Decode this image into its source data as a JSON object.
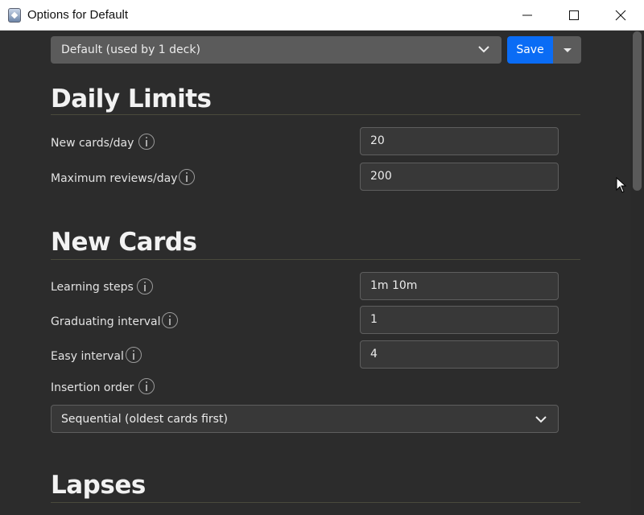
{
  "window": {
    "title": "Options for Default",
    "icon": "anki-app-icon",
    "controls": [
      "minimize",
      "maximize",
      "close"
    ]
  },
  "toolbar": {
    "preset_value": "Default (used by 1 deck)",
    "save_label": "Save"
  },
  "sections": {
    "daily_limits": {
      "title": "Daily Limits",
      "new_cards_label": "New cards/day",
      "new_cards_value": "20",
      "max_reviews_label": "Maximum reviews/day",
      "max_reviews_value": "200"
    },
    "new_cards": {
      "title": "New Cards",
      "learning_steps_label": "Learning steps",
      "learning_steps_value": "1m 10m",
      "graduating_interval_label": "Graduating interval",
      "graduating_interval_value": "1",
      "easy_interval_label": "Easy interval",
      "easy_interval_value": "4",
      "insertion_order_label": "Insertion order",
      "insertion_order_value": "Sequential (oldest cards first)"
    },
    "lapses": {
      "title": "Lapses"
    }
  },
  "colors": {
    "background": "#2c2c2c",
    "accent": "#0a6cf5",
    "field_bg": "#383838"
  }
}
